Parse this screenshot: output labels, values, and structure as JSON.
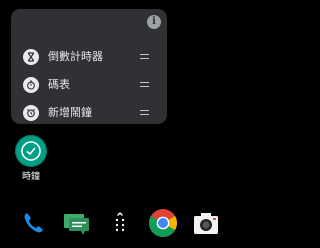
{
  "popup": {
    "info_glyph": "i",
    "items": [
      {
        "label": "倒數計時器",
        "icon": "hourglass-icon"
      },
      {
        "label": "碼表",
        "icon": "stopwatch-icon"
      },
      {
        "label": "新增鬧鐘",
        "icon": "alarm-clock-icon"
      }
    ]
  },
  "app": {
    "label": "時鐘",
    "icon": "clock-icon",
    "color": "#00a087"
  },
  "dock": [
    {
      "name": "phone",
      "icon": "phone-icon",
      "color": "#1e88e5"
    },
    {
      "name": "messages",
      "icon": "messages-icon",
      "color": "#2e9e5b"
    },
    {
      "name": "app-drawer",
      "icon": "app-drawer-icon",
      "color": "#ffffff"
    },
    {
      "name": "chrome",
      "icon": "chrome-icon",
      "color": "#db4437"
    },
    {
      "name": "camera",
      "icon": "camera-icon",
      "color": "#f2f2f2"
    }
  ]
}
